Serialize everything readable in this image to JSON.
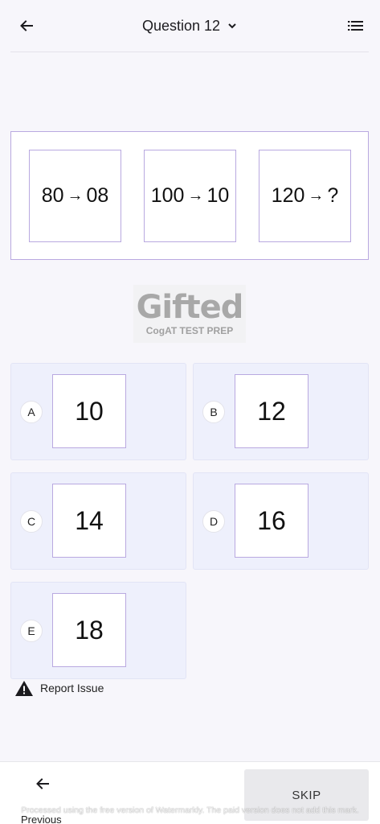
{
  "app_bar": {
    "back_icon": "arrow-left-icon",
    "title": "Question 12",
    "dropdown_icon": "chevron-down-icon",
    "list_icon": "list-icon"
  },
  "question": {
    "cells": [
      {
        "left": "80",
        "arrow": "→",
        "right": "08"
      },
      {
        "left": "100",
        "arrow": "→",
        "right": "10"
      },
      {
        "left": "120",
        "arrow": "→",
        "right": "?"
      }
    ]
  },
  "logo": {
    "main": "Gifted",
    "sub": "CogAT TEST PREP"
  },
  "options": [
    {
      "letter": "A",
      "value": "10"
    },
    {
      "letter": "B",
      "value": "12"
    },
    {
      "letter": "C",
      "value": "14"
    },
    {
      "letter": "D",
      "value": "16"
    },
    {
      "letter": "E",
      "value": "18"
    }
  ],
  "report": {
    "icon": "warning-icon",
    "label": "Report Issue"
  },
  "bottom": {
    "previous_icon": "arrow-left-icon",
    "previous_label": "Previous",
    "skip_label": "SKIP"
  },
  "watermark": "Processed using the free version of Watermarkly. The paid version does not add this mark."
}
